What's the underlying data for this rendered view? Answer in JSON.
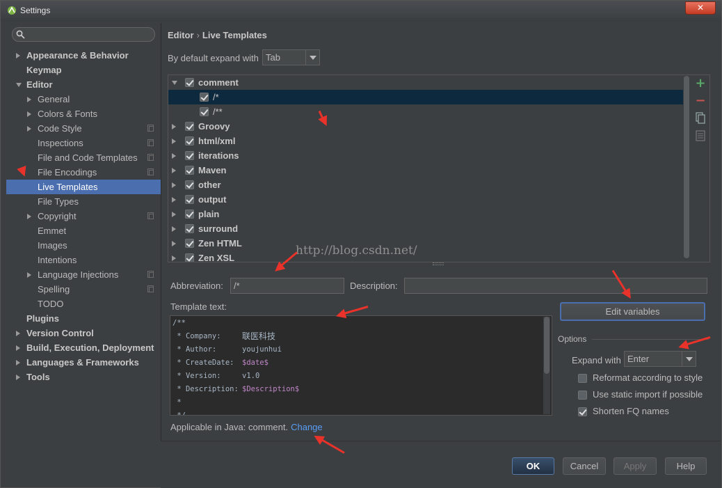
{
  "window": {
    "title": "Settings",
    "close_label": "✕"
  },
  "search": {
    "placeholder": "",
    "value": ""
  },
  "sidebar": {
    "items": [
      {
        "label": "Appearance & Behavior",
        "level": 0,
        "arrow": "r",
        "copy": false
      },
      {
        "label": "Keymap",
        "level": 0,
        "arrow": "",
        "copy": false
      },
      {
        "label": "Editor",
        "level": 0,
        "arrow": "d",
        "copy": false
      },
      {
        "label": "General",
        "level": 1,
        "arrow": "r",
        "copy": false
      },
      {
        "label": "Colors & Fonts",
        "level": 1,
        "arrow": "r",
        "copy": false
      },
      {
        "label": "Code Style",
        "level": 1,
        "arrow": "r",
        "copy": true
      },
      {
        "label": "Inspections",
        "level": 1,
        "arrow": "",
        "copy": true
      },
      {
        "label": "File and Code Templates",
        "level": 1,
        "arrow": "",
        "copy": true
      },
      {
        "label": "File Encodings",
        "level": 1,
        "arrow": "",
        "copy": true
      },
      {
        "label": "Live Templates",
        "level": 1,
        "arrow": "",
        "copy": false,
        "selected": true
      },
      {
        "label": "File Types",
        "level": 1,
        "arrow": "",
        "copy": false
      },
      {
        "label": "Copyright",
        "level": 1,
        "arrow": "r",
        "copy": true
      },
      {
        "label": "Emmet",
        "level": 1,
        "arrow": "",
        "copy": false
      },
      {
        "label": "Images",
        "level": 1,
        "arrow": "",
        "copy": false
      },
      {
        "label": "Intentions",
        "level": 1,
        "arrow": "",
        "copy": false
      },
      {
        "label": "Language Injections",
        "level": 1,
        "arrow": "r",
        "copy": true
      },
      {
        "label": "Spelling",
        "level": 1,
        "arrow": "",
        "copy": true
      },
      {
        "label": "TODO",
        "level": 1,
        "arrow": "",
        "copy": false
      },
      {
        "label": "Plugins",
        "level": 0,
        "arrow": "",
        "copy": false
      },
      {
        "label": "Version Control",
        "level": 0,
        "arrow": "r",
        "copy": false
      },
      {
        "label": "Build, Execution, Deployment",
        "level": 0,
        "arrow": "r",
        "copy": false
      },
      {
        "label": "Languages & Frameworks",
        "level": 0,
        "arrow": "r",
        "copy": false
      },
      {
        "label": "Tools",
        "level": 0,
        "arrow": "r",
        "copy": false
      }
    ]
  },
  "breadcrumb": {
    "first": "Editor",
    "separator": "›",
    "second": "Live Templates"
  },
  "expand": {
    "label": "By default expand with",
    "value": "Tab"
  },
  "templates": [
    {
      "label": "comment",
      "level": 0,
      "arrow": "d",
      "checked": true
    },
    {
      "label": "/*",
      "level": 1,
      "arrow": "",
      "checked": true,
      "selected": true
    },
    {
      "label": "/**",
      "level": 1,
      "arrow": "",
      "checked": true
    },
    {
      "label": "Groovy",
      "level": 0,
      "arrow": "r",
      "checked": true
    },
    {
      "label": "html/xml",
      "level": 0,
      "arrow": "r",
      "checked": true
    },
    {
      "label": "iterations",
      "level": 0,
      "arrow": "r",
      "checked": true
    },
    {
      "label": "Maven",
      "level": 0,
      "arrow": "r",
      "checked": true
    },
    {
      "label": "other",
      "level": 0,
      "arrow": "r",
      "checked": true
    },
    {
      "label": "output",
      "level": 0,
      "arrow": "r",
      "checked": true
    },
    {
      "label": "plain",
      "level": 0,
      "arrow": "r",
      "checked": true
    },
    {
      "label": "surround",
      "level": 0,
      "arrow": "r",
      "checked": true
    },
    {
      "label": "Zen HTML",
      "level": 0,
      "arrow": "r",
      "checked": true
    },
    {
      "label": "Zen XSL",
      "level": 0,
      "arrow": "r",
      "checked": true
    }
  ],
  "toolbar": {
    "add": "+",
    "remove": "−"
  },
  "watermark": "http://blog.csdn.net/",
  "abbreviation": {
    "label": "Abbreviation:",
    "value": "/*"
  },
  "description": {
    "label": "Description:",
    "value": ""
  },
  "template_text": {
    "label": "Template text:",
    "lines": [
      {
        "key": "/**",
        "value": "",
        "var": false
      },
      {
        "key": " * Company:",
        "value": "联医科技",
        "var": false,
        "cn": true
      },
      {
        "key": " * Author:",
        "value": "youjunhui",
        "var": false
      },
      {
        "key": " * CreateDate:",
        "value": "$date$",
        "var": true
      },
      {
        "key": " * Version:",
        "value": "v1.0",
        "var": false
      },
      {
        "key": " * Description:",
        "value": "$Description$",
        "var": true
      },
      {
        "key": " *",
        "value": "",
        "var": false
      },
      {
        "key": " */",
        "value": "",
        "var": false
      }
    ]
  },
  "applicable": {
    "text": "Applicable in Java: comment.",
    "link": "Change"
  },
  "edit_variables": "Edit variables",
  "options": {
    "label": "Options",
    "expand_label": "Expand with",
    "expand_value": "Enter",
    "checks": [
      {
        "label": "Reformat according to style",
        "checked": false
      },
      {
        "label": "Use static import if possible",
        "checked": false
      },
      {
        "label": "Shorten FQ names",
        "checked": true
      }
    ]
  },
  "buttons": {
    "ok": "OK",
    "cancel": "Cancel",
    "apply": "Apply",
    "help": "Help"
  },
  "colors": {
    "selection": "#4b6eaf",
    "tree_selection": "#0d293e",
    "accent_red": "#e8322a",
    "link": "#589df6"
  }
}
